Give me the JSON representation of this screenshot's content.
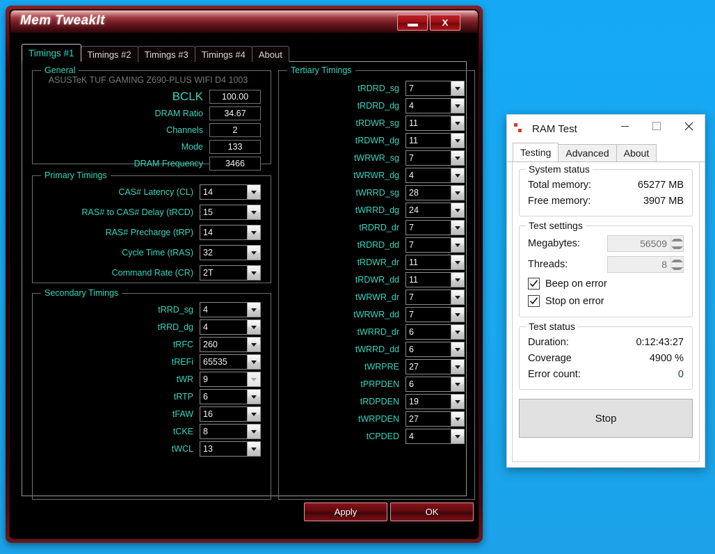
{
  "memtweakit": {
    "title": "Mem TweakIt",
    "window_buttons": {
      "minimize": "minimize-icon",
      "close": "X"
    },
    "tabs": [
      {
        "label": "Timings #1",
        "active": true
      },
      {
        "label": "Timings #2",
        "active": false
      },
      {
        "label": "Timings #3",
        "active": false
      },
      {
        "label": "Timings #4",
        "active": false
      },
      {
        "label": "About",
        "active": false
      }
    ],
    "general": {
      "title": "General",
      "motherboard": "ASUSTeK TUF GAMING Z690-PLUS WIFI D4 1003",
      "rows": [
        {
          "label": "BCLK",
          "value": "100.00"
        },
        {
          "label": "DRAM Ratio",
          "value": "34.67"
        },
        {
          "label": "Channels",
          "value": "2"
        },
        {
          "label": "Mode",
          "value": "133"
        },
        {
          "label": "DRAM Frequency",
          "value": "3466"
        }
      ]
    },
    "primary": {
      "title": "Primary Timings",
      "rows": [
        {
          "label": "CAS# Latency (CL)",
          "value": "14"
        },
        {
          "label": "RAS# to CAS# Delay (tRCD)",
          "value": "15"
        },
        {
          "label": "RAS# Precharge (tRP)",
          "value": "14"
        },
        {
          "label": "Cycle Time (tRAS)",
          "value": "32"
        },
        {
          "label": "Command Rate (CR)",
          "value": "2T"
        }
      ]
    },
    "secondary": {
      "title": "Secondary Timings",
      "rows": [
        {
          "label": "tRRD_sg",
          "value": "4"
        },
        {
          "label": "tRRD_dg",
          "value": "4"
        },
        {
          "label": "tRFC",
          "value": "260"
        },
        {
          "label": "tREFi",
          "value": "65535"
        },
        {
          "label": "tWR",
          "value": "9"
        },
        {
          "label": "tRTP",
          "value": "6"
        },
        {
          "label": "tFAW",
          "value": "16"
        },
        {
          "label": "tCKE",
          "value": "8"
        },
        {
          "label": "tWCL",
          "value": "13"
        }
      ]
    },
    "tertiary": {
      "title": "Tertiary Timings",
      "rows": [
        {
          "label": "tRDRD_sg",
          "value": "7"
        },
        {
          "label": "tRDRD_dg",
          "value": "4"
        },
        {
          "label": "tRDWR_sg",
          "value": "11"
        },
        {
          "label": "tRDWR_dg",
          "value": "11"
        },
        {
          "label": "tWRWR_sg",
          "value": "7"
        },
        {
          "label": "tWRWR_dg",
          "value": "4"
        },
        {
          "label": "tWRRD_sg",
          "value": "28"
        },
        {
          "label": "tWRRD_dg",
          "value": "24"
        },
        {
          "label": "tRDRD_dr",
          "value": "7"
        },
        {
          "label": "tRDRD_dd",
          "value": "7"
        },
        {
          "label": "tRDWR_dr",
          "value": "11"
        },
        {
          "label": "tRDWR_dd",
          "value": "11"
        },
        {
          "label": "tWRWR_dr",
          "value": "7"
        },
        {
          "label": "tWRWR_dd",
          "value": "7"
        },
        {
          "label": "tWRRD_dr",
          "value": "6"
        },
        {
          "label": "tWRRD_dd",
          "value": "6"
        },
        {
          "label": "tWRPRE",
          "value": "27"
        },
        {
          "label": "tPRPDEN",
          "value": "6"
        },
        {
          "label": "tRDPDEN",
          "value": "19"
        },
        {
          "label": "tWRPDEN",
          "value": "27"
        },
        {
          "label": "tCPDED",
          "value": "4"
        }
      ]
    },
    "footer": {
      "apply_label": "Apply",
      "ok_label": "OK"
    },
    "colors": {
      "label_teal": "#35d6c0",
      "title_red": "#9e3a40",
      "value_white": "#f2f2f2"
    }
  },
  "ramtest": {
    "title": "RAM Test",
    "window_buttons": {
      "minimize": "minimize-icon",
      "maximize": "maximize-icon",
      "close": "close-icon"
    },
    "tabs": [
      {
        "label": "Testing",
        "active": true
      },
      {
        "label": "Advanced",
        "active": false
      },
      {
        "label": "About",
        "active": false
      }
    ],
    "system_status": {
      "title": "System status",
      "rows": [
        {
          "label": "Total memory:",
          "value": "65277 MB"
        },
        {
          "label": "Free memory:",
          "value": "3907 MB"
        }
      ]
    },
    "test_settings": {
      "title": "Test settings",
      "megabytes_label": "Megabytes:",
      "megabytes_value": "56509",
      "threads_label": "Threads:",
      "threads_value": "8",
      "beep_label": "Beep on error",
      "beep_checked": true,
      "stop_label": "Stop on error",
      "stop_checked": true
    },
    "test_status": {
      "title": "Test status",
      "rows": [
        {
          "label": "Duration:",
          "value": "0:12:43:27"
        },
        {
          "label": "Coverage",
          "value": "4900 %"
        },
        {
          "label": "Error count:",
          "value": "0"
        }
      ]
    },
    "stop_button_label": "Stop"
  }
}
